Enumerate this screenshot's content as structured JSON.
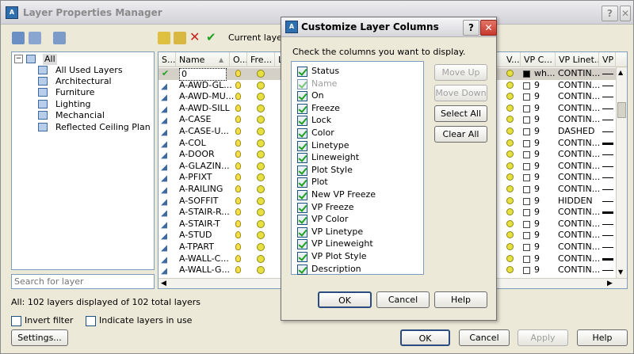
{
  "window": {
    "title": "Layer Properties Manager",
    "help_btn": "?",
    "close_btn": "X"
  },
  "toolbar": {
    "current_layer": "Current layer: 0"
  },
  "tree": {
    "items": [
      "All",
      "All Used Layers",
      "Architectural",
      "Furniture",
      "Lighting",
      "Mechancial",
      "Reflected Ceiling Plan"
    ]
  },
  "search": {
    "placeholder": "Search for layer"
  },
  "grid": {
    "headers_left": [
      "S...",
      "Name",
      "O...",
      "Fre...",
      "L"
    ],
    "headers_right": [
      "V...",
      "VP C...",
      "VP Linet...",
      "VP"
    ],
    "rows": [
      {
        "name": "0",
        "vpcolor": "wh...",
        "vplinetype": "CONTIN...",
        "lineweight": "thin"
      },
      {
        "name": "A-AWD-GL...",
        "vpcolor": "9",
        "vplinetype": "CONTIN...",
        "lineweight": "thin"
      },
      {
        "name": "A-AWD-MU...",
        "vpcolor": "9",
        "vplinetype": "CONTIN...",
        "lineweight": "thin"
      },
      {
        "name": "A-AWD-SILL",
        "vpcolor": "9",
        "vplinetype": "CONTIN...",
        "lineweight": "thin"
      },
      {
        "name": "A-CASE",
        "vpcolor": "9",
        "vplinetype": "CONTIN...",
        "lineweight": "thin"
      },
      {
        "name": "A-CASE-U...",
        "vpcolor": "9",
        "vplinetype": "DASHED",
        "lineweight": "thin"
      },
      {
        "name": "A-COL",
        "vpcolor": "9",
        "vplinetype": "CONTIN...",
        "lineweight": "thick"
      },
      {
        "name": "A-DOOR",
        "vpcolor": "9",
        "vplinetype": "CONTIN...",
        "lineweight": "thin"
      },
      {
        "name": "A-GLAZIN...",
        "vpcolor": "9",
        "vplinetype": "CONTIN...",
        "lineweight": "thin"
      },
      {
        "name": "A-PFIXT",
        "vpcolor": "9",
        "vplinetype": "CONTIN...",
        "lineweight": "thin"
      },
      {
        "name": "A-RAILING",
        "vpcolor": "9",
        "vplinetype": "CONTIN...",
        "lineweight": "thin"
      },
      {
        "name": "A-SOFFIT",
        "vpcolor": "9",
        "vplinetype": "HIDDEN",
        "lineweight": "thin"
      },
      {
        "name": "A-STAIR-R...",
        "vpcolor": "9",
        "vplinetype": "CONTIN...",
        "lineweight": "thick"
      },
      {
        "name": "A-STAIR-T",
        "vpcolor": "9",
        "vplinetype": "CONTIN...",
        "lineweight": "thin"
      },
      {
        "name": "A-STUD",
        "vpcolor": "9",
        "vplinetype": "CONTIN...",
        "lineweight": "thin"
      },
      {
        "name": "A-TPART",
        "vpcolor": "9",
        "vplinetype": "CONTIN...",
        "lineweight": "thin"
      },
      {
        "name": "A-WALL-C...",
        "vpcolor": "9",
        "vplinetype": "CONTIN...",
        "lineweight": "thick"
      },
      {
        "name": "A-WALL-G...",
        "vpcolor": "9",
        "vplinetype": "CONTIN...",
        "lineweight": "thin"
      }
    ]
  },
  "status": {
    "text": "All: 102 layers displayed of 102 total layers"
  },
  "bottom": {
    "invert_filter": "Invert filter",
    "indicate_layers": "Indicate layers in use",
    "settings": "Settings...",
    "ok": "OK",
    "cancel": "Cancel",
    "apply": "Apply",
    "help": "Help"
  },
  "dialog": {
    "title": "Customize Layer Columns",
    "help_btn": "?",
    "close_btn": "X",
    "instruction": "Check the columns you want to display.",
    "columns": [
      {
        "label": "Status",
        "checked": true,
        "disabled": false
      },
      {
        "label": "Name",
        "checked": true,
        "disabled": true
      },
      {
        "label": "On",
        "checked": true,
        "disabled": false
      },
      {
        "label": "Freeze",
        "checked": true,
        "disabled": false
      },
      {
        "label": "Lock",
        "checked": true,
        "disabled": false
      },
      {
        "label": "Color",
        "checked": true,
        "disabled": false
      },
      {
        "label": "Linetype",
        "checked": true,
        "disabled": false
      },
      {
        "label": "Lineweight",
        "checked": true,
        "disabled": false
      },
      {
        "label": "Plot Style",
        "checked": true,
        "disabled": false
      },
      {
        "label": "Plot",
        "checked": true,
        "disabled": false
      },
      {
        "label": "New VP Freeze",
        "checked": true,
        "disabled": false
      },
      {
        "label": "VP Freeze",
        "checked": true,
        "disabled": false
      },
      {
        "label": "VP Color",
        "checked": true,
        "disabled": false
      },
      {
        "label": "VP Linetype",
        "checked": true,
        "disabled": false
      },
      {
        "label": "VP Lineweight",
        "checked": true,
        "disabled": false
      },
      {
        "label": "VP Plot Style",
        "checked": true,
        "disabled": false
      },
      {
        "label": "Description",
        "checked": true,
        "disabled": false
      }
    ],
    "move_up": "Move Up",
    "move_down": "Move Down",
    "select_all": "Select All",
    "clear_all": "Clear All",
    "ok": "OK",
    "cancel": "Cancel",
    "help": "Help"
  },
  "colors": {
    "accent": "#316ac5",
    "close_red": "#d4453a",
    "check_green": "#21a121"
  }
}
